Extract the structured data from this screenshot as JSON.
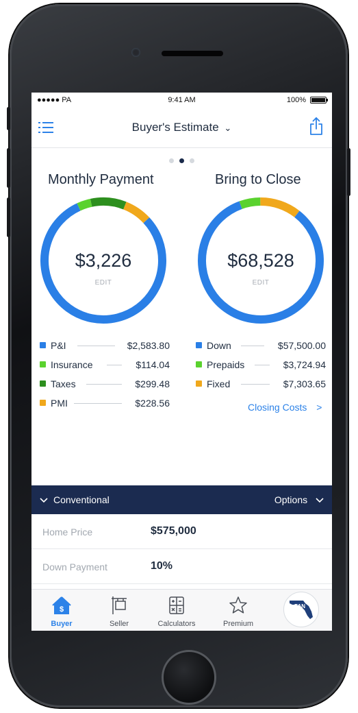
{
  "status_bar": {
    "carrier": "●●●●● PA",
    "time": "9:41 AM",
    "battery": "100%"
  },
  "nav": {
    "title": "Buyer's Estimate",
    "chevron": "⌄",
    "menu_icon": "list-icon",
    "share_icon": "share-icon"
  },
  "pager": {
    "count": 3,
    "active_index": 1
  },
  "monthly_payment": {
    "title": "Monthly Payment",
    "amount": "$3,226",
    "edit_label": "EDIT",
    "items": [
      {
        "label": "P&I",
        "value": "$2,583.80",
        "amount": 2583.8,
        "color": "#2a7fe6"
      },
      {
        "label": "Insurance",
        "value": "$114.04",
        "amount": 114.04,
        "color": "#5ad22e"
      },
      {
        "label": "Taxes",
        "value": "$299.48",
        "amount": 299.48,
        "color": "#2d8f1e"
      },
      {
        "label": "PMI",
        "value": "$228.56",
        "amount": 228.56,
        "color": "#f0a81c"
      }
    ]
  },
  "bring_to_close": {
    "title": "Bring to Close",
    "amount": "$68,528",
    "edit_label": "EDIT",
    "items": [
      {
        "label": "Down",
        "value": "$57,500.00",
        "amount": 57500.0,
        "color": "#2a7fe6"
      },
      {
        "label": "Prepaids",
        "value": "$3,724.94",
        "amount": 3724.94,
        "color": "#5ad22e"
      },
      {
        "label": "Fixed",
        "value": "$7,303.65",
        "amount": 7303.65,
        "color": "#f0a81c"
      }
    ],
    "link_label": "Closing Costs",
    "link_chevron": ">"
  },
  "loan_bar": {
    "loan_type": "Conventional",
    "options_label": "Options",
    "chevron": "⌄"
  },
  "fields": [
    {
      "label": "Home Price",
      "value": "$575,000"
    },
    {
      "label": "Down Payment",
      "value": "10%"
    }
  ],
  "tabs": [
    {
      "label": "Buyer",
      "icon": "house-icon",
      "active": true
    },
    {
      "label": "Seller",
      "icon": "sign-icon",
      "active": false
    },
    {
      "label": "Calculators",
      "icon": "calculator-icon",
      "active": false
    },
    {
      "label": "Premium",
      "icon": "star-icon",
      "active": false
    }
  ],
  "badge": {
    "text": "FAN",
    "icon": "florida-logo-icon"
  },
  "colors": {
    "accent": "#2c82e8",
    "navy": "#1b2b50",
    "text": "#1f2c3f"
  }
}
